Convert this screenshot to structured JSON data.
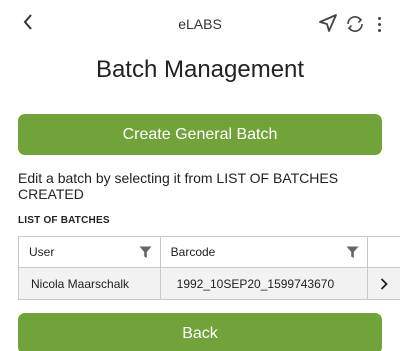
{
  "header": {
    "app_title": "eLABS",
    "icons": [
      "chevron-left-icon",
      "navigation-arrow-icon",
      "sync-icon",
      "more-vertical-icon"
    ]
  },
  "page": {
    "title": "Batch Management",
    "instruction": "Edit a batch by selecting it from LIST OF BATCHES CREATED",
    "list_heading": "LIST OF BATCHES"
  },
  "buttons": {
    "create_label": "Create General Batch",
    "back_label": "Back"
  },
  "table": {
    "columns": [
      "User",
      "Barcode"
    ],
    "rows": [
      {
        "user": "Nicola Maarschalk",
        "barcode": "1992_10SEP20_1599743670"
      }
    ]
  },
  "colors": {
    "accent_green": "#72a23a",
    "row_bg": "#f2f2f2",
    "border": "#c8c8c8"
  }
}
